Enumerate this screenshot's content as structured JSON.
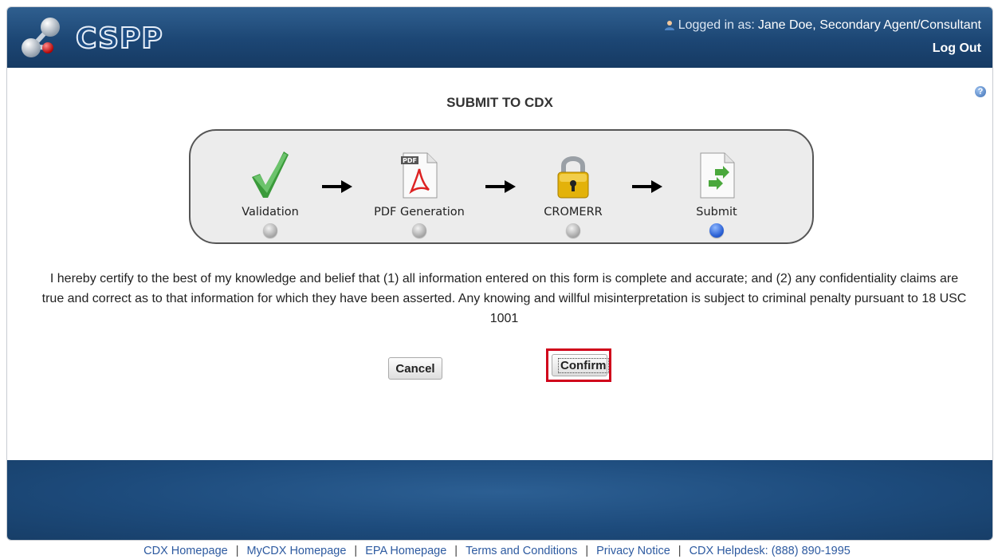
{
  "header": {
    "logo_text": "CSPP",
    "logged_in_prefix": "Logged in as:",
    "user_name": "Jane Doe, Secondary Agent/Consultant",
    "logout_label": "Log Out"
  },
  "help_icon": "help-icon",
  "page_title": "SUBMIT TO CDX",
  "wizard": {
    "steps": [
      {
        "label": "Validation",
        "icon": "checkmark-icon",
        "active": false
      },
      {
        "label": "PDF Generation",
        "icon": "pdf-icon",
        "active": false
      },
      {
        "label": "CROMERR",
        "icon": "lock-icon",
        "active": false
      },
      {
        "label": "Submit",
        "icon": "submit-document-icon",
        "active": true
      }
    ]
  },
  "certification_text": "I hereby certify to the best of my knowledge and belief that (1) all information entered on this form is complete and accurate; and (2) any confidentiality claims are true and correct as to that information for which they have been asserted. Any knowing and willful misinterpretation is subject to criminal penalty pursuant to 18 USC 1001",
  "buttons": {
    "cancel_label": "Cancel",
    "confirm_label": "Confirm"
  },
  "footer": {
    "links": [
      "CDX Homepage",
      "MyCDX Homepage",
      "EPA Homepage",
      "Terms and Conditions",
      "Privacy Notice",
      "CDX Helpdesk: (888) 890-1995"
    ],
    "separator": "|"
  },
  "colors": {
    "header_blue": "#1c4674",
    "highlight_red": "#d0021b",
    "link_blue": "#2d5aa0",
    "active_dot": "#2f64d6"
  }
}
